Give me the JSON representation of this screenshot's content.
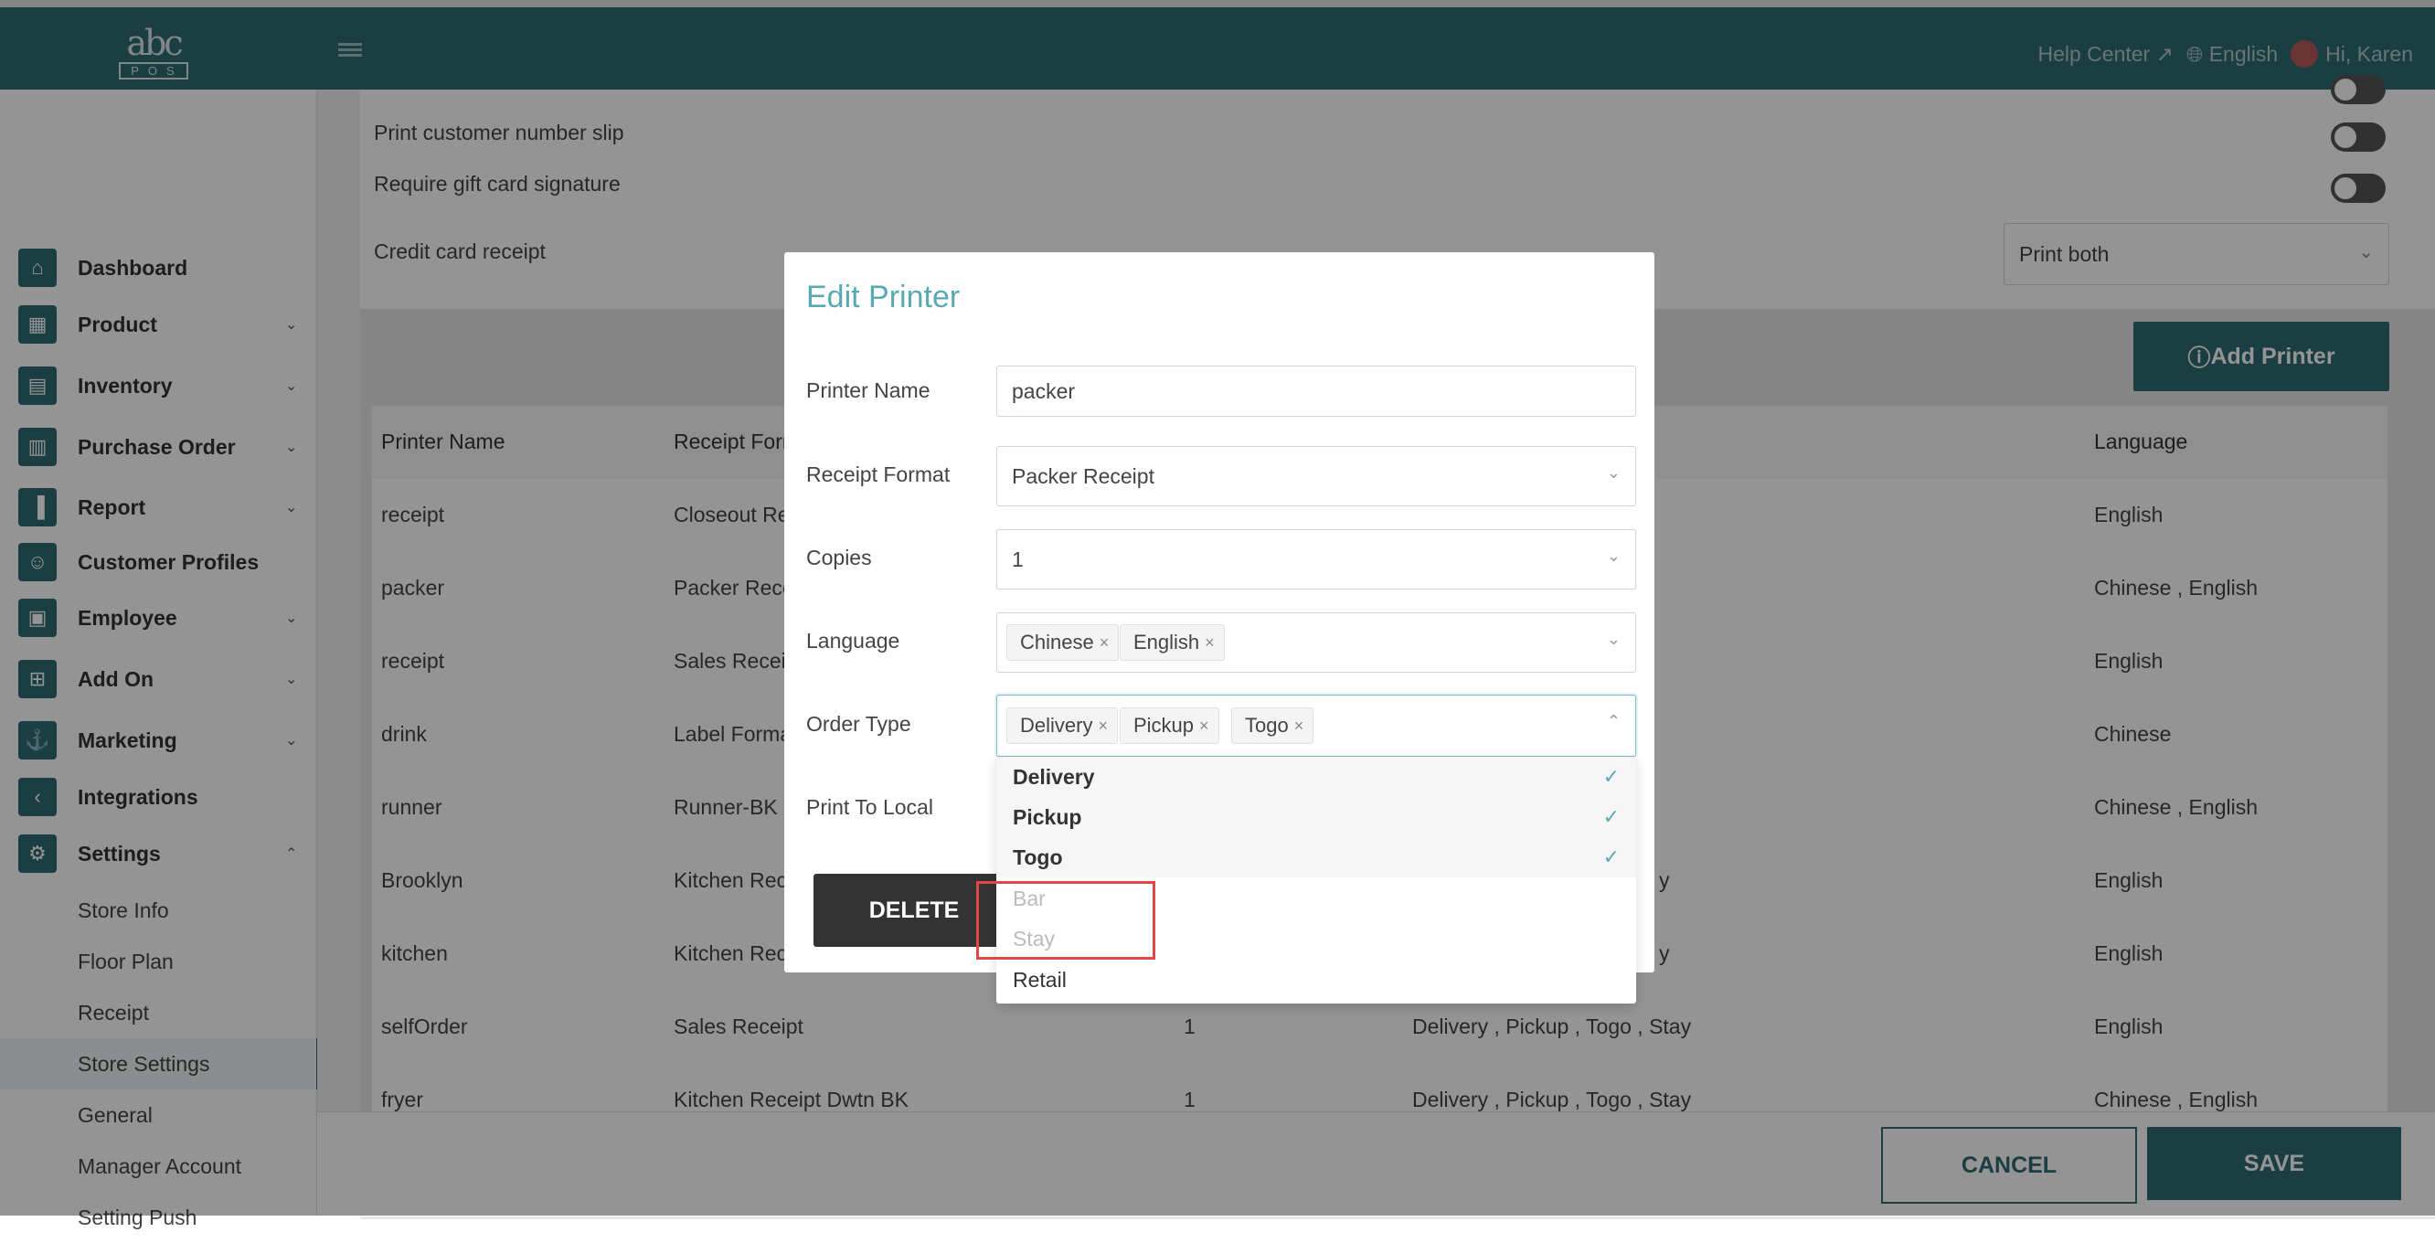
{
  "topbar": {
    "logo_text": "abc",
    "logo_sub": "POS",
    "help_center": "Help Center",
    "language": "English",
    "greeting": "Hi, Karen"
  },
  "sidebar": {
    "items": [
      {
        "label": "Dashboard",
        "icon": "home-icon"
      },
      {
        "label": "Product",
        "icon": "grid-icon"
      },
      {
        "label": "Inventory",
        "icon": "clipboard-icon"
      },
      {
        "label": "Purchase Order",
        "icon": "order-icon"
      },
      {
        "label": "Report",
        "icon": "bar-chart-icon"
      },
      {
        "label": "Customer Profiles",
        "icon": "user-icon"
      },
      {
        "label": "Employee",
        "icon": "badge-icon"
      },
      {
        "label": "Add On",
        "icon": "addon-icon"
      },
      {
        "label": "Marketing",
        "icon": "marketing-icon"
      },
      {
        "label": "Integrations",
        "icon": "share-icon"
      },
      {
        "label": "Settings",
        "icon": "settings-icon"
      }
    ],
    "settings_sub": [
      "Store Info",
      "Floor Plan",
      "Receipt",
      "Store Settings",
      "General",
      "Manager Account",
      "Setting Push"
    ]
  },
  "settings": {
    "row_customer_slip": "Print customer number slip",
    "row_gift_card": "Require gift card signature",
    "row_credit_receipt": "Credit card receipt",
    "credit_receipt_value": "Print both",
    "add_printer": "Add Printer"
  },
  "table": {
    "headers": [
      "Printer Name",
      "Receipt Format",
      "Language"
    ],
    "rows": [
      {
        "name": "receipt",
        "format": "Closeout Re",
        "copies": "",
        "order": "",
        "language": "English"
      },
      {
        "name": "packer",
        "format": "Packer Rece",
        "copies": "",
        "order": "",
        "language": "Chinese , English"
      },
      {
        "name": "receipt",
        "format": "Sales Receip",
        "copies": "",
        "order": "",
        "language": "English"
      },
      {
        "name": "drink",
        "format": "Label Forma",
        "copies": "",
        "order": "",
        "language": "Chinese"
      },
      {
        "name": "runner",
        "format": "Runner-BK",
        "copies": "",
        "order": "",
        "language": "Chinese , English"
      },
      {
        "name": "Brooklyn",
        "format": "Kitchen Rec",
        "copies": "",
        "order": "y",
        "language": "English"
      },
      {
        "name": "kitchen",
        "format": "Kitchen Rec",
        "copies": "",
        "order": "y",
        "language": "English"
      },
      {
        "name": "selfOrder",
        "format": "Sales Receipt",
        "copies": "1",
        "order": "Delivery , Pickup , Togo , Stay",
        "language": "English"
      },
      {
        "name": "fryer",
        "format": "Kitchen Receipt Dwtn BK",
        "copies": "1",
        "order": "Delivery , Pickup , Togo , Stay",
        "language": "Chinese , English"
      }
    ]
  },
  "footer": {
    "cancel": "CANCEL",
    "save": "SAVE"
  },
  "modal": {
    "title": "Edit Printer",
    "printer_name_label": "Printer Name",
    "printer_name_value": "packer",
    "receipt_format_label": "Receipt Format",
    "receipt_format_value": "Packer Receipt",
    "copies_label": "Copies",
    "copies_value": "1",
    "language_label": "Language",
    "language_tags": [
      "Chinese",
      "English"
    ],
    "order_type_label": "Order Type",
    "order_type_tags": [
      "Delivery",
      "Pickup",
      "Togo"
    ],
    "print_to_local_label": "Print To Local",
    "delete": "DELETE",
    "dropdown_options": [
      {
        "label": "Delivery",
        "state": "selected"
      },
      {
        "label": "Pickup",
        "state": "selected"
      },
      {
        "label": "Togo",
        "state": "selected"
      },
      {
        "label": "Bar",
        "state": "disabled"
      },
      {
        "label": "Stay",
        "state": "disabled"
      },
      {
        "label": "Retail",
        "state": "normal"
      }
    ]
  },
  "colors": {
    "brand": "#2f6b73",
    "accent": "#58aab0",
    "highlight": "#e04848"
  }
}
